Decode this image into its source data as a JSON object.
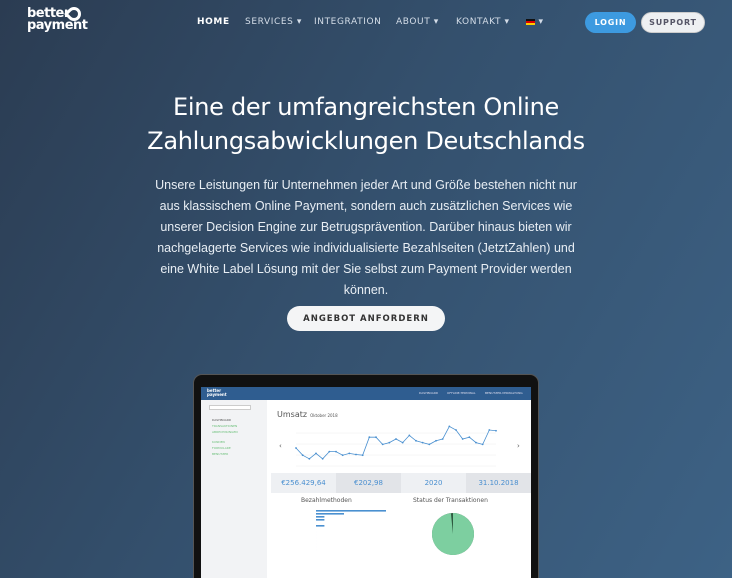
{
  "brand": {
    "line1": "better",
    "line2": "payment"
  },
  "nav": {
    "items": [
      {
        "label": "HOME"
      },
      {
        "label": "SERVICES ▾"
      },
      {
        "label": "INTEGRATION"
      },
      {
        "label": "ABOUT ▾"
      },
      {
        "label": "KONTAKT ▾"
      },
      {
        "label": "▾"
      }
    ],
    "login": "LOGIN",
    "support": "SUPPORT",
    "language_icon": "german-flag-icon"
  },
  "hero": {
    "title_line1": "Eine der umfangreichsten Online",
    "title_line2": "Zahlungsabwicklungen Deutschlands",
    "text": "Unsere Leistungen für Unternehmen jeder Art und Größe bestehen nicht nur aus klassischem Online Payment, sondern auch zusätzlichen Services wie unserer Decision Engine zur Betrugsprävention. Darüber hinaus bieten wir nachgelagerte Services wie individualisierte Bezahlseiten (JetztZahlen) und eine White Label Lösung mit der Sie selbst zum Payment Provider werden können.",
    "cta": "ANGEBOT ANFORDERN"
  },
  "dashboard": {
    "tabs": [
      "DASHBOARD",
      "OFFLINE-TERMINAL",
      "BENUTZER-VERWALTUNG"
    ],
    "sidebar": [
      "DASHBOARD",
      "TRANSAKTIONEN",
      "ABRECHNUNGEN",
      "KUNDEN",
      "FORMULARE",
      "BENUTZER"
    ],
    "revenue_title": "Umsatz",
    "revenue_period": "Oktober 2018",
    "revenue_series": [
      5,
      3,
      2,
      3.5,
      2,
      4,
      4,
      3,
      3.5,
      3.2,
      3,
      8,
      8,
      6,
      6.5,
      7.5,
      6.5,
      8.5,
      7,
      6.5,
      6,
      7,
      7.5,
      11,
      10,
      7.5,
      8,
      6.5,
      6,
      10,
      9.8
    ],
    "kpis": [
      "€256.429,64",
      "€202,98",
      "2020",
      "31.10.2018"
    ],
    "methods_title": "Bezahlmethoden",
    "methods": [
      100,
      40,
      12,
      12,
      0,
      12,
      0,
      0,
      0,
      0,
      0,
      0,
      0,
      0
    ],
    "status_title": "Status der Transaktionen",
    "status_share_percent": 98.4,
    "status_color": "#7dcfa0",
    "bar_color": "#4a90d0"
  }
}
